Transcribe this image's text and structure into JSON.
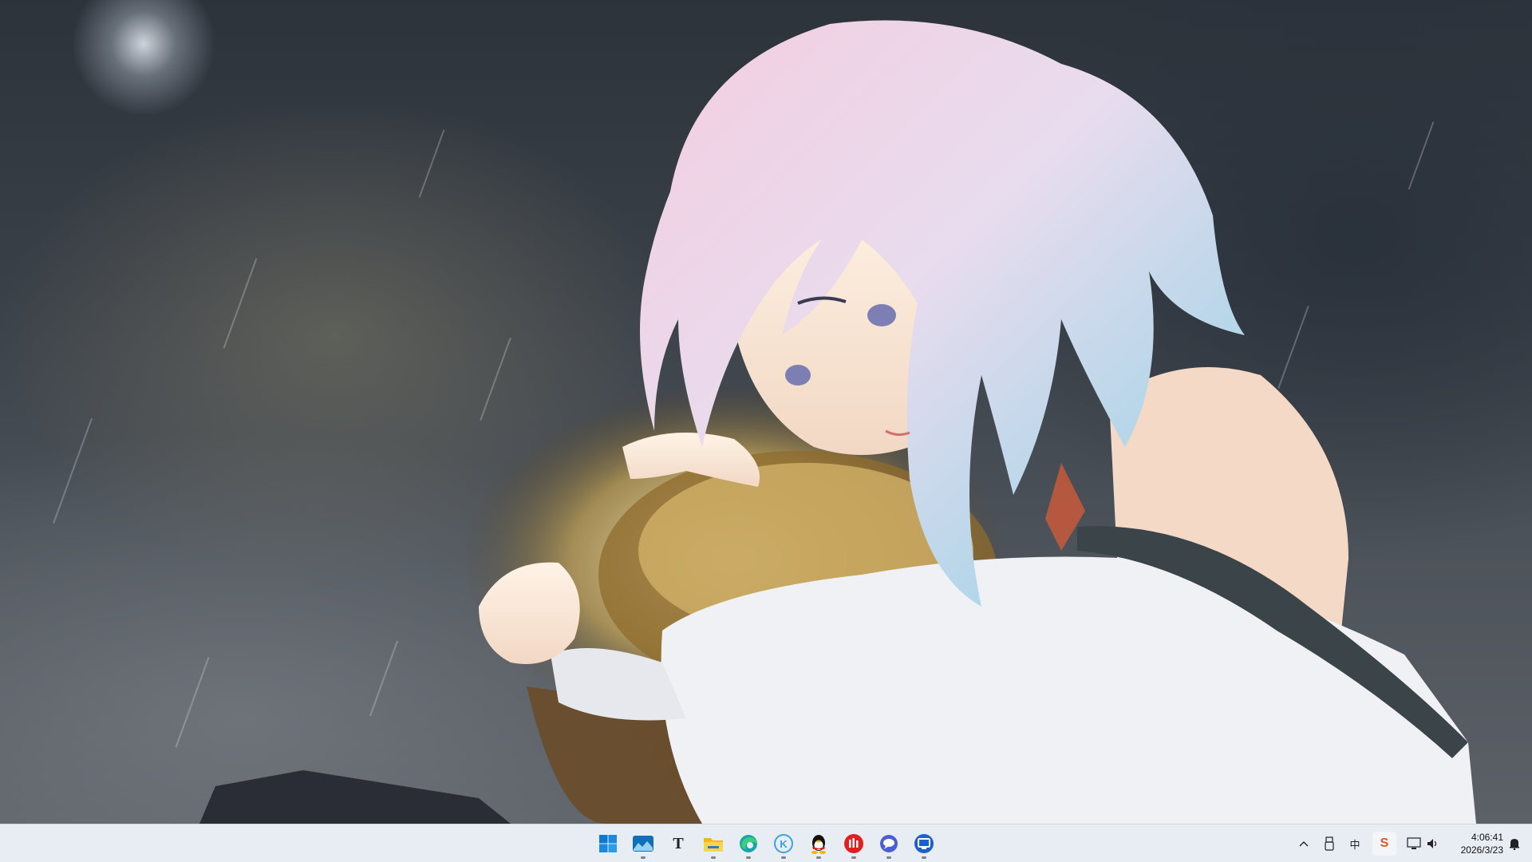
{
  "taskbar": {
    "apps": [
      {
        "name": "start",
        "label": ""
      },
      {
        "name": "weather-widgets",
        "label": ""
      },
      {
        "name": "typora",
        "label": "T"
      },
      {
        "name": "file-explorer",
        "label": ""
      },
      {
        "name": "edge",
        "label": ""
      },
      {
        "name": "kuaishou",
        "label": "K"
      },
      {
        "name": "qq",
        "label": ""
      },
      {
        "name": "netease-music",
        "label": ""
      },
      {
        "name": "chat",
        "label": ""
      },
      {
        "name": "remote-desktop",
        "label": ""
      }
    ],
    "tray": {
      "overflow": "^",
      "ime": "中",
      "sogou": "S",
      "volume": "🔊"
    },
    "clock": {
      "time": "4:06:41",
      "date": "2026/3/23"
    }
  },
  "colors": {
    "taskbar_bg": "#e8ecf3",
    "start_blue": "#0a78d4",
    "edge_teal": "#1aa4a8",
    "netease_red": "#e02020",
    "qq_black": "#111111"
  }
}
